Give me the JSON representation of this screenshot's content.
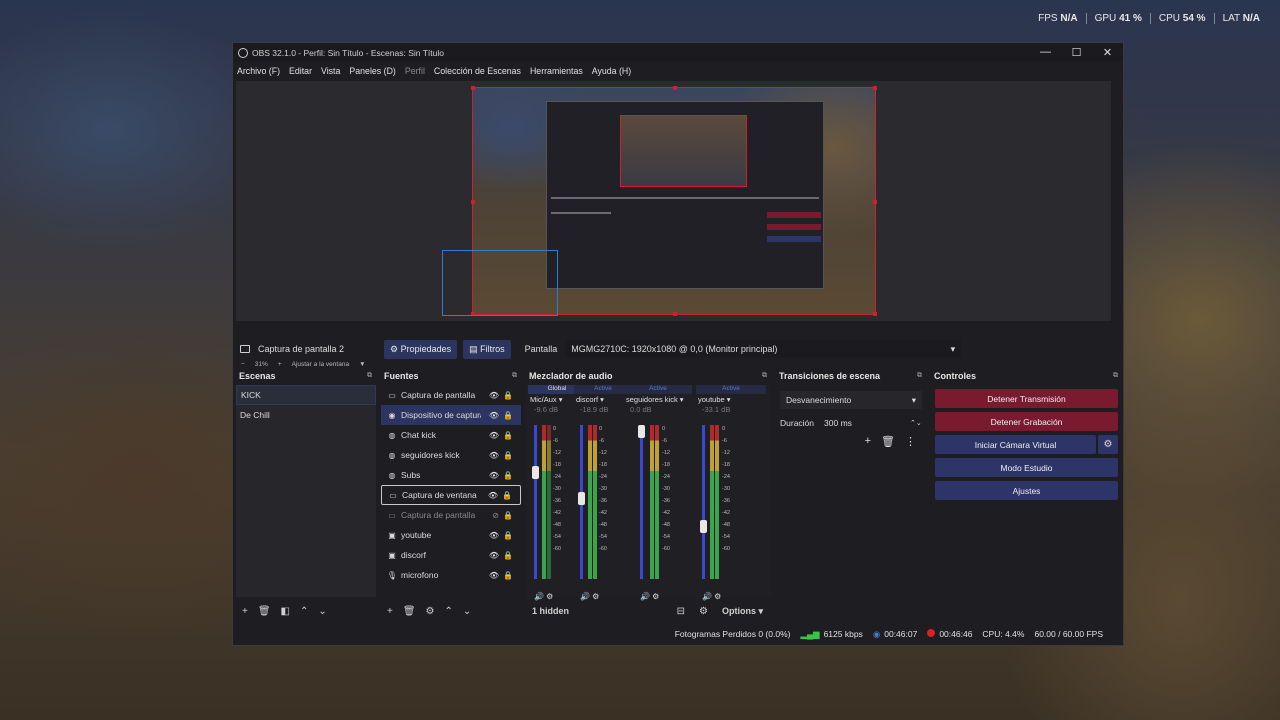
{
  "overlay": {
    "fps_label": "FPS",
    "fps_value": "N/A",
    "gpu_label": "GPU",
    "gpu_value": "41 %",
    "cpu_label": "CPU",
    "cpu_value": "54 %",
    "lat_label": "LAT",
    "lat_value": "N/A"
  },
  "window": {
    "title": "OBS 32.1.0 - Perfil: Sin Título - Escenas: Sin Título",
    "minimize": "—",
    "maximize": "☐",
    "close": "✕"
  },
  "menu": [
    "Archivo (F)",
    "Editar",
    "Vista",
    "Paneles (D)",
    "Perfil",
    "Colección de Escenas",
    "Herramientas",
    "Ayuda (H)"
  ],
  "preview": {
    "zoom_minus": "−",
    "zoom_value": "31%",
    "zoom_plus": "+",
    "fit_label": "Ajustar a la ventana",
    "fit_arrow": "▼"
  },
  "source_toolbar": {
    "source_name": "Captura de pantalla 2",
    "properties": "Propiedades",
    "filters": "Filtros",
    "display_label": "Pantalla",
    "display_value": "MGMG2710C: 1920x1080 @ 0,0 (Monitor principal)"
  },
  "scenes": {
    "title": "Escenas",
    "items": [
      "KICK",
      "De Chill"
    ]
  },
  "sources": {
    "title": "Fuentes",
    "items": [
      {
        "name": "Captura de pantalla",
        "icon": "▭"
      },
      {
        "name": "Dispositivo de captura",
        "icon": "◉"
      },
      {
        "name": "Chat kick",
        "icon": "◍"
      },
      {
        "name": "seguidores kick",
        "icon": "◍"
      },
      {
        "name": "Subs",
        "icon": "◍"
      },
      {
        "name": "Captura de ventana",
        "icon": "▭"
      },
      {
        "name": "Captura de pantalla",
        "icon": "▭"
      },
      {
        "name": "youtube",
        "icon": "▣"
      },
      {
        "name": "discorf",
        "icon": "▣"
      },
      {
        "name": "microfono",
        "icon": "🎙"
      }
    ]
  },
  "mixer": {
    "title": "Mezclador de audio",
    "channels": [
      {
        "tag": "Global",
        "name": "Mic/Aux",
        "db": "-9.6 dB",
        "level": 0.72
      },
      {
        "tag": "Active",
        "name": "discorf",
        "db": "-18.9 dB",
        "level": 0.55
      },
      {
        "tag": "Active",
        "name": "seguidores kick",
        "db": "0.0 dB",
        "level": 1.0
      },
      {
        "tag": "Active",
        "name": "youtube",
        "db": "-33.1 dB",
        "level": 0.36
      }
    ],
    "ticks": [
      "0",
      "-6",
      "-12",
      "-18",
      "-24",
      "-30",
      "-36",
      "-42",
      "-48",
      "-54",
      "-60"
    ],
    "hidden": "1 hidden",
    "options": "Options"
  },
  "transitions": {
    "title": "Transiciones de escena",
    "type": "Desvanecimiento",
    "duration_label": "Duración",
    "duration_value": "300 ms"
  },
  "controls": {
    "title": "Controles",
    "stop_stream": "Detener Transmisión",
    "stop_record": "Detener Grabación",
    "virtual_cam": "Iniciar Cámara Virtual",
    "studio_mode": "Modo Estudio",
    "settings": "Ajustes"
  },
  "status": {
    "dropped": "Fotogramas Perdidos 0 (0.0%)",
    "bitrate": "6125 kbps",
    "stream_time": "00:46:07",
    "rec_time": "00:46:46",
    "cpu": "CPU: 4.4%",
    "fps": "60.00 / 60.00 FPS"
  }
}
